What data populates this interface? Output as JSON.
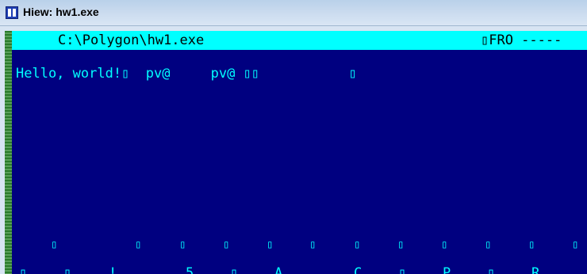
{
  "window": {
    "title": "Hiew: hw1.exe",
    "icon": "hiew-app-icon"
  },
  "status_bar": {
    "path": "C:\\Polygon\\hw1.exe",
    "mode": "▯FRO -----"
  },
  "text_lines": [
    "Hello, world!▯  pv@     pv@ ▯▯           ▯"
  ],
  "row2_glyphs": [
    "▯",
    "▯",
    "▯",
    "▯",
    "▯",
    "▯",
    "▯",
    "▯",
    "▯",
    "▯",
    "▯",
    "▯",
    "▯"
  ],
  "row3_chars": [
    "▯",
    "▯",
    "!",
    "5",
    "▯",
    "A",
    "C",
    "▯",
    "P",
    "▯",
    "R"
  ],
  "colors": {
    "background": "#000080",
    "text": "#00ffff",
    "status_bg": "#00ffff",
    "status_text": "#000000"
  }
}
